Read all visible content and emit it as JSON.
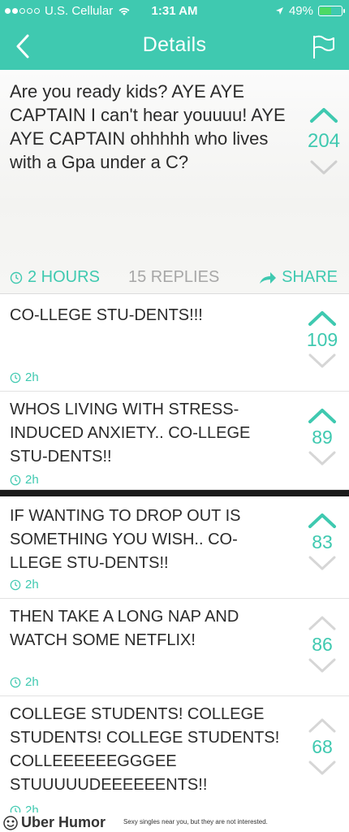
{
  "status": {
    "carrier": "U.S. Cellular",
    "time": "1:31 AM",
    "battery": "49%",
    "battery_level": 0.49
  },
  "nav": {
    "title": "Details"
  },
  "post": {
    "text": "Are you ready kids? AYE AYE CAPTAIN I can't hear youuuu! AYE AYE CAPTAIN ohhhhh who lives with a Gpa under a C?",
    "votes": "204",
    "time": "2 HOURS",
    "replies": "15 REPLIES",
    "share": "SHARE"
  },
  "replies": [
    {
      "text": "CO-LLEGE STU-DENTS!!!",
      "votes": "109",
      "age": "2h"
    },
    {
      "text": "WHOS LIVING WITH STRESS-INDUCED ANXIETY.. CO-LLEGE STU-DENTS!!",
      "votes": "89",
      "age": "2h"
    },
    {
      "text": "IF WANTING TO DROP OUT IS SOMETHING YOU WISH.. CO-LLEGE STU-DENTS!!",
      "votes": "83",
      "age": "2h"
    },
    {
      "text": "THEN TAKE A LONG NAP AND WATCH SOME NETFLIX!",
      "votes": "86",
      "age": "2h"
    },
    {
      "text": "COLLEGE STUDENTS! COLLEGE STUDENTS! COLLEGE STUDENTS! COLLEEEEEEGGGEE STUUUUUDEEEEEENTS!!",
      "votes": "68",
      "age": "2h"
    }
  ],
  "footer": {
    "brand": "Uber Humor",
    "ad": "Sexy singles near you, but they are not interested."
  },
  "colors": {
    "accent": "#3fc9b0",
    "muted": "#a7a7a7"
  },
  "icons": [
    "back-chevron-icon",
    "flag-icon",
    "wifi-icon",
    "location-arrow-icon",
    "clock-icon",
    "share-arrow-icon",
    "upvote-icon",
    "downvote-icon"
  ]
}
